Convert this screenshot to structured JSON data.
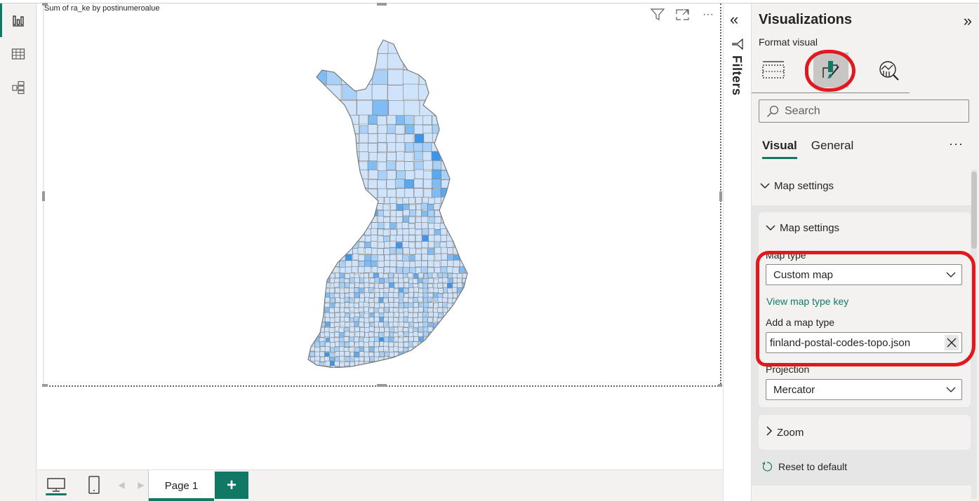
{
  "left_rail": {
    "items": [
      {
        "name": "report-view",
        "icon": "bar-chart-icon",
        "active": true
      },
      {
        "name": "table-view",
        "icon": "table-grid-icon",
        "active": false
      },
      {
        "name": "model-view",
        "icon": "model-icon",
        "active": false
      }
    ]
  },
  "visual": {
    "title": "Sum of ra_ke by postinumeroalue",
    "actions": [
      "filter-icon",
      "focus-mode-icon",
      "more-options-icon"
    ],
    "more_label": "···",
    "map": {
      "type": "shape-map",
      "region": "Finland postal code areas",
      "fill_scale": [
        "#cfe4fb",
        "#a9d1f8",
        "#7fbcf5",
        "#5aa8f0",
        "#3d95ea"
      ],
      "border_color": "#808080"
    }
  },
  "bottom_bar": {
    "desktop_icon": "desktop-icon",
    "mobile_icon": "mobile-icon",
    "page_tab": "Page 1",
    "add_page_label": "+"
  },
  "filters_pane": {
    "collapse_label": "«",
    "label": "Filters"
  },
  "viz_pane": {
    "title": "Visualizations",
    "expand_label": "»",
    "subtitle": "Format visual",
    "tabs": [
      {
        "name": "build-visual",
        "icon": "build-visual-icon",
        "active": false
      },
      {
        "name": "format-visual",
        "icon": "format-paintbrush-icon",
        "active": true
      },
      {
        "name": "analytics",
        "icon": "analytics-icon",
        "active": false
      }
    ],
    "search_placeholder": "Search",
    "subtabs": [
      "Visual",
      "General"
    ],
    "more_label": "···",
    "section_title": "Map settings",
    "card_title": "Map settings",
    "map_type_label": "Map type",
    "map_type_value": "Custom map",
    "view_key_link": "View map type key",
    "add_map_type_label": "Add a map type",
    "add_map_type_value": "finland-postal-codes-topo.json",
    "projection_label": "Projection",
    "projection_value": "Mercator",
    "zoom_card_title": "Zoom",
    "reset_label": "Reset to default",
    "accent_color": "#117865",
    "annotation_color": "#e0191e"
  }
}
